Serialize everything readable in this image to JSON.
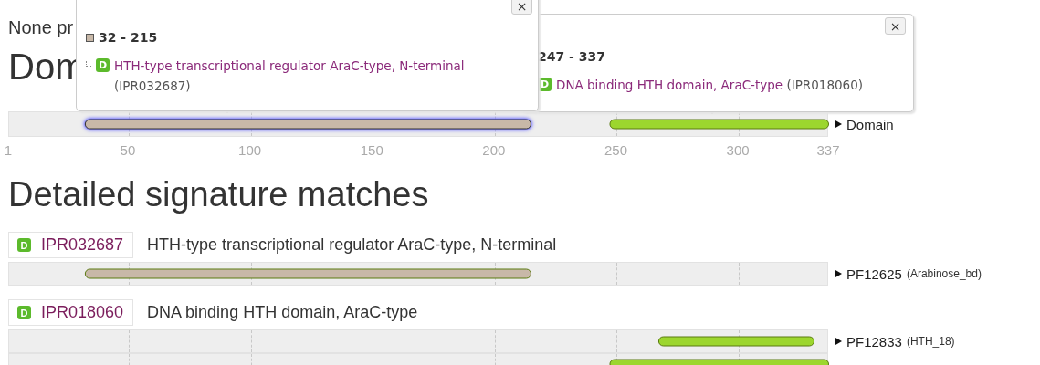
{
  "intro": "None pr",
  "heading": "Dom",
  "domain_track": {
    "label": "Domain",
    "bars": [
      {
        "color": "#c8b8a8",
        "selected": true
      },
      {
        "color": "#9cd62e",
        "selected": false
      }
    ]
  },
  "axis": [
    "1",
    "50",
    "100",
    "150",
    "200",
    "250",
    "300",
    "337"
  ],
  "popups": [
    {
      "range": "32 - 215",
      "badge": "D",
      "name": "HTH-type transcriptional regulator AraC-type, N-terminal",
      "accession": "(IPR032687)",
      "close": "×"
    },
    {
      "range": "247 - 337",
      "badge": "D",
      "name": "DNA binding HTH domain, AraC-type",
      "accession": "(IPR018060)",
      "close": "×"
    }
  ],
  "section_heading": "Detailed signature matches",
  "entries": [
    {
      "badge": "D",
      "accession": "IPR032687",
      "name": "HTH-type transcriptional regulator AraC-type, N-terminal",
      "tracks": [
        {
          "signature": "PF12625",
          "short_name": "(Arabinose_bd)",
          "color": "#c8b8a8"
        }
      ]
    },
    {
      "badge": "D",
      "accession": "IPR018060",
      "name": "DNA binding HTH domain, AraC-type",
      "tracks": [
        {
          "signature": "PF12833",
          "short_name": "(HTH_18)",
          "color": "#9cd62e"
        },
        {
          "color": "#9cd62e"
        }
      ]
    }
  ]
}
